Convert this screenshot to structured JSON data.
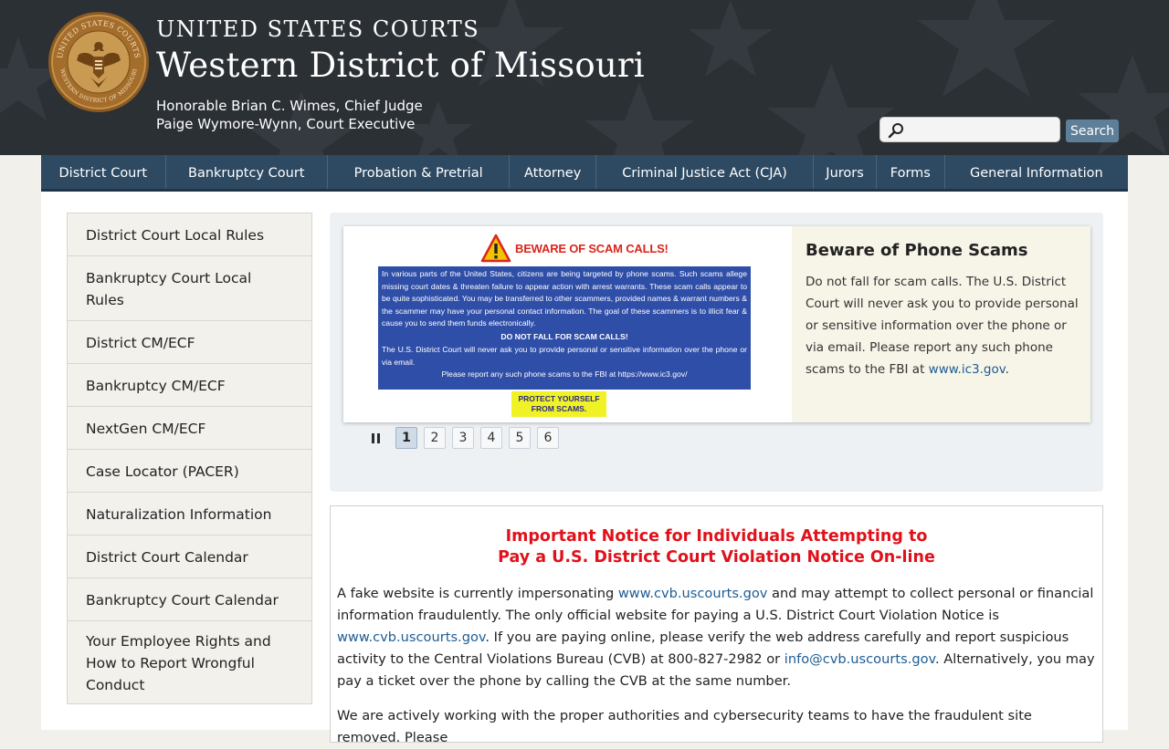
{
  "header": {
    "kicker": "UNITED STATES COURTS",
    "title": "Western District of Missouri",
    "chief_judge": "Honorable Brian C. Wimes, Chief Judge",
    "court_executive": "Paige Wymore-Wynn, Court Executive",
    "seal_text_top": "UNITED STATES COURTS",
    "seal_text_bottom": "WESTERN DISTRICT OF MISSOURI"
  },
  "search": {
    "placeholder": "",
    "value": "",
    "button_label": "Search"
  },
  "nav": [
    "District Court",
    "Bankruptcy Court",
    "Probation & Pretrial",
    "Attorney",
    "Criminal Justice Act (CJA)",
    "Jurors",
    "Forms",
    "General Information"
  ],
  "sidebar": [
    "District Court Local Rules",
    "Bankruptcy Court Local Rules",
    "District CM/ECF",
    "Bankruptcy CM/ECF",
    "NextGen CM/ECF",
    "Case Locator (PACER)",
    "Naturalization Information",
    "District Court Calendar",
    "Bankruptcy Court Calendar",
    "Your Employee Rights and How to Report Wrongful Conduct"
  ],
  "slide": {
    "image_title": "BEWARE OF SCAM CALLS!",
    "image_body": "In various parts of the United States, citizens are being targeted by phone scams. Such scams allege missing court dates & threaten failure to appear action with arrest warrants. These scam calls appear to be quite sophisticated. You may be transferred to other scammers, provided names & warrant numbers & the scammer may have your personal contact information. The goal of these scammers is to illicit fear & cause you to send them funds electronically.",
    "image_callout": "DO NOT FALL FOR SCAM CALLS!",
    "image_body2": "The U.S. District Court will never ask you to provide personal or sensitive information over the phone or via email.",
    "image_report": "Please report any such phone scams to the FBI at https://www.ic3.gov/",
    "image_badge_line1": "PROTECT YOURSELF",
    "image_badge_line2": "FROM SCAMS.",
    "heading": "Beware of Phone Scams",
    "text": "Do not fall for scam calls. The U.S. District Court will never ask you to provide personal or sensitive information over the phone or via email. Please report any such phone scams to the FBI at ",
    "link": "www.ic3.gov",
    "text_end": "."
  },
  "pager": {
    "pages": [
      "1",
      "2",
      "3",
      "4",
      "5",
      "6"
    ],
    "active": 1
  },
  "notice": {
    "heading_line1": "Important Notice for Individuals Attempting to",
    "heading_line2": "Pay a U.S. District Court Violation Notice On-line",
    "p1_a": "A fake website is currently impersonating ",
    "p1_link1": "www.cvb.uscourts.gov",
    "p1_b": " and may attempt to collect personal or financial information fraudulently. The only official website for paying a U.S. District Court Violation Notice is ",
    "p1_link2": "www.cvb.uscourts.gov",
    "p1_c": ". If you are paying online, please verify the web address carefully and report suspicious activity to the Central Violations Bureau (CVB) at 800-827-2982 or ",
    "p1_link3": "info@cvb.uscourts.gov",
    "p1_d": ". Alternatively, you may pay a ticket over the phone by calling the CVB at the same number.",
    "p2": "We are actively working with the proper authorities and cybersecurity teams to have the fraudulent site removed. Please"
  },
  "colors": {
    "header_bg": "#2b3035",
    "nav_bg": "#2e4a62",
    "notice_red": "#e0111a",
    "link": "#1d5c93",
    "scam_blue": "#2f4ea8"
  }
}
